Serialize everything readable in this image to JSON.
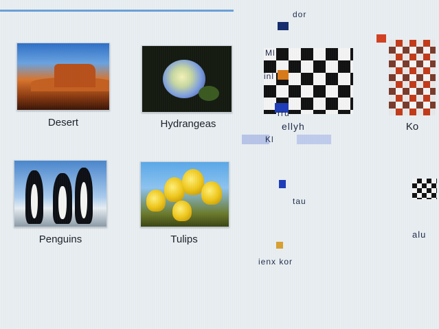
{
  "files": [
    {
      "label": "Desert"
    },
    {
      "label": "Hydrangeas"
    },
    {
      "label": "Penguins"
    },
    {
      "label": "Tulips"
    },
    {
      "label": "Ko"
    }
  ],
  "glitch_text": [
    "dor",
    "ellyh",
    "rru",
    "tau",
    "ienx kor",
    "alu",
    "Ml",
    "inl",
    "Kl"
  ],
  "colors": {
    "accent": "#6aa0d8",
    "background": "#e9eef1"
  }
}
